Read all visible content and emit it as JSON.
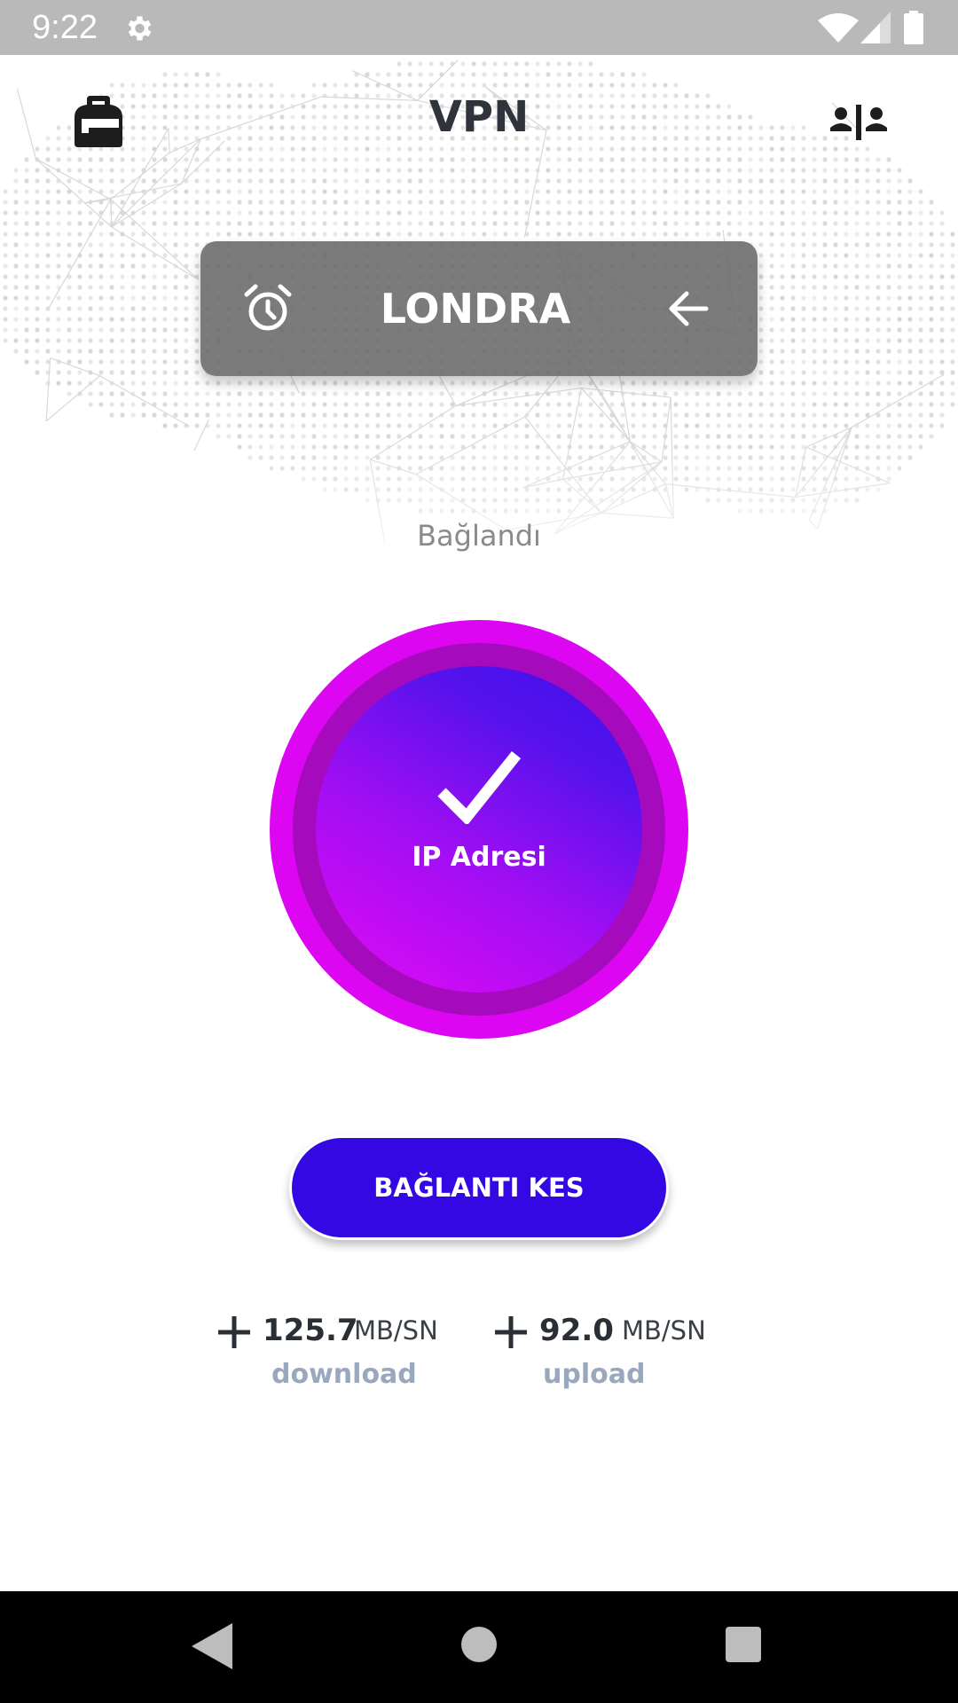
{
  "status_bar": {
    "time": "9:22",
    "icons": [
      "gear-icon",
      "wifi-icon",
      "signal-icon",
      "battery-icon"
    ]
  },
  "app_bar": {
    "title": "VPN",
    "left_icon": "backpack-icon",
    "right_icon": "users-icon"
  },
  "location": {
    "name": "LONDRA",
    "left_icon": "alarm-clock-icon",
    "right_icon": "arrow-left-icon"
  },
  "connection": {
    "status": "Bağlandı",
    "button_label": "IP Adresi",
    "button_icon": "check-icon"
  },
  "disconnect": {
    "label": "BAĞLANTI KES"
  },
  "stats": {
    "download": {
      "value": "125.7",
      "unit": "MB/SN",
      "label": "download",
      "icon": "plus-icon"
    },
    "upload": {
      "value": "92.0",
      "unit": "MB/SN",
      "label": "upload",
      "icon": "plus-icon"
    }
  },
  "nav_bar": {
    "icons": [
      "back-icon",
      "home-icon",
      "recents-icon"
    ]
  },
  "colors": {
    "status_bar": "#b9b9b9",
    "title_text": "#2f343c",
    "location_card": "#696969",
    "ring_outer": "#dd06f2",
    "ring_mid": "#a60abd",
    "core_start": "#e20af4",
    "core_end": "#4010ea",
    "disconnect_button": "#3308e3",
    "stat_label": "#9aa8bd",
    "nav_bar": "#000000"
  }
}
